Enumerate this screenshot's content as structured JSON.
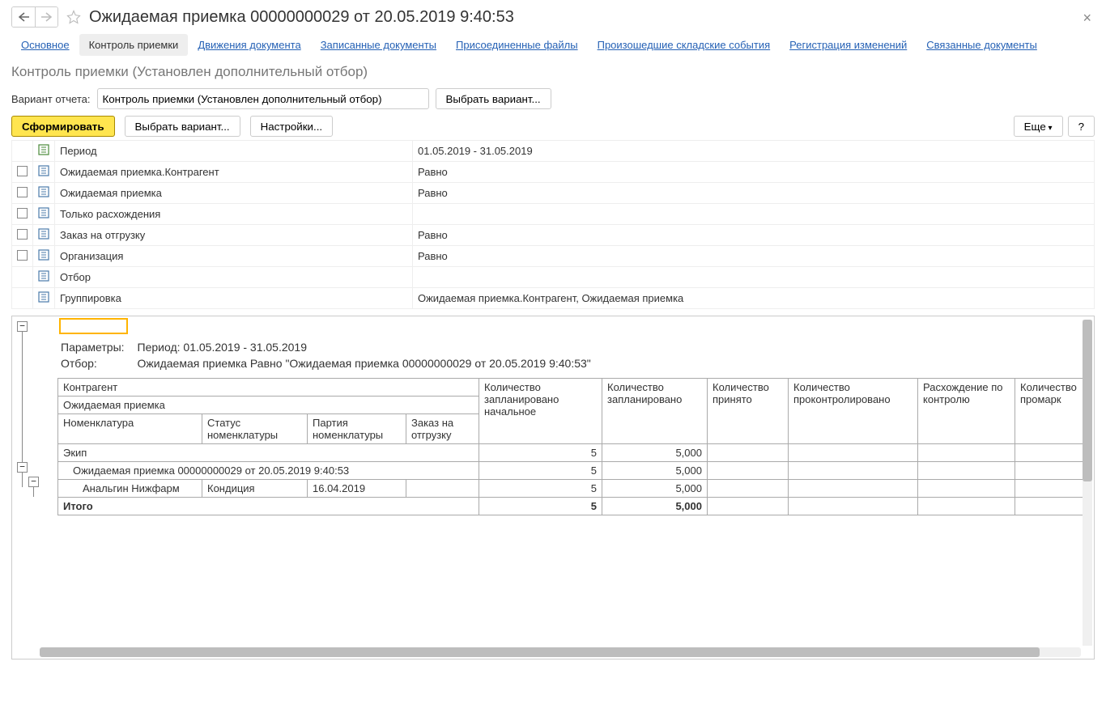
{
  "header": {
    "title": "Ожидаемая приемка 00000000029 от 20.05.2019 9:40:53"
  },
  "tabs": [
    "Основное",
    "Контроль приемки",
    "Движения документа",
    "Записанные документы",
    "Присоединенные файлы",
    "Произошедшие складские события",
    "Регистрация изменений",
    "Связанные документы"
  ],
  "subtitle": "Контроль приемки (Установлен дополнительный отбор)",
  "variant": {
    "label": "Вариант отчета:",
    "value": "Контроль приемки (Установлен дополнительный отбор)",
    "select_btn": "Выбрать вариант..."
  },
  "toolbar": {
    "form": "Сформировать",
    "select": "Выбрать вариант...",
    "settings": "Настройки...",
    "more": "Еще",
    "help": "?"
  },
  "filters": [
    {
      "chk": false,
      "icon": "param-green",
      "name": "Период",
      "val": "01.05.2019 - 31.05.2019",
      "has_chk": false
    },
    {
      "chk": false,
      "icon": "param-blue",
      "name": "Ожидаемая приемка.Контрагент",
      "val": "Равно",
      "has_chk": true
    },
    {
      "chk": false,
      "icon": "param-blue",
      "name": "Ожидаемая приемка",
      "val": "Равно",
      "has_chk": true
    },
    {
      "chk": false,
      "icon": "param-blue",
      "name": "Только расхождения",
      "val": "",
      "has_chk": true
    },
    {
      "chk": false,
      "icon": "param-blue",
      "name": "Заказ на отгрузку",
      "val": "Равно",
      "has_chk": true
    },
    {
      "chk": false,
      "icon": "param-blue",
      "name": "Организация",
      "val": "Равно",
      "has_chk": true
    },
    {
      "chk": false,
      "icon": "param-blue",
      "name": "Отбор",
      "val": "",
      "has_chk": false
    },
    {
      "chk": false,
      "icon": "param-blue",
      "name": "Группировка",
      "val": "Ожидаемая приемка.Контрагент, Ожидаемая приемка",
      "has_chk": false
    }
  ],
  "report": {
    "params_label": "Параметры:",
    "params_value": "Период: 01.05.2019 - 31.05.2019",
    "filter_label": "Отбор:",
    "filter_value": "Ожидаемая приемка Равно \"Ожидаемая приемка 00000000029 от 20.05.2019 9:40:53\"",
    "cols": {
      "contragent": "Контрагент",
      "expected": "Ожидаемая приемка",
      "nomen": "Номенклатура",
      "status": "Статус номенклатуры",
      "batch": "Партия номенклатуры",
      "order": "Заказ на отгрузку",
      "qty_plan_init": "Количество запланировано начальное",
      "qty_plan": "Количество запланировано",
      "qty_accepted": "Количество принято",
      "qty_checked": "Количество проконтролировано",
      "diff": "Расхождение по контролю",
      "qty_mark": "Количество промарк"
    },
    "rows": {
      "r1_name": "Экип",
      "r1_v1": "5",
      "r1_v2": "5,000",
      "r2_name": "Ожидаемая приемка 00000000029 от 20.05.2019 9:40:53",
      "r2_v1": "5",
      "r2_v2": "5,000",
      "r3_nomen": "Анальгин Нижфарм",
      "r3_status": "Кондиция",
      "r3_batch": "16.04.2019",
      "r3_v1": "5",
      "r3_v2": "5,000",
      "total": "Итого",
      "t_v1": "5",
      "t_v2": "5,000"
    }
  }
}
